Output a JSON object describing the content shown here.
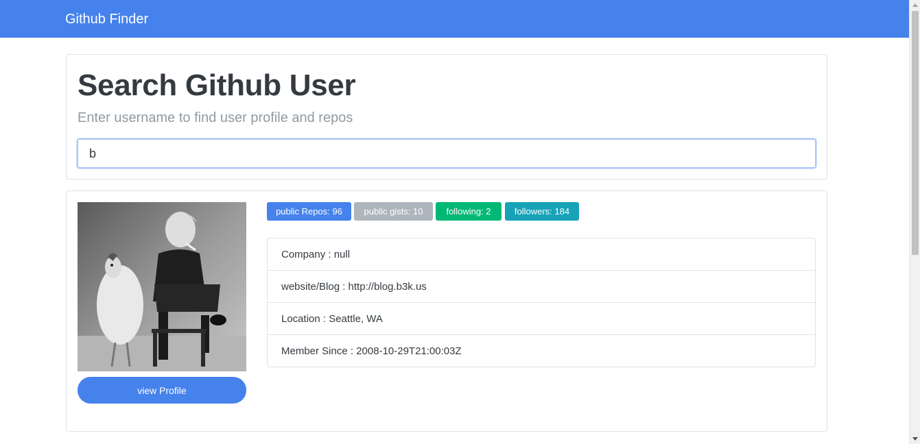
{
  "navbar": {
    "brand": "Github Finder"
  },
  "search": {
    "title": "Search Github User",
    "subtitle": "Enter username to find user profile and repos",
    "input_value": "b"
  },
  "profile": {
    "view_profile_label": "view Profile",
    "badges": {
      "public_repos": "public Repos: 96",
      "public_gists": "public gists: 10",
      "following": "following: 2",
      "followers": "followers: 184"
    },
    "info": {
      "company": "Company : null",
      "website": "website/Blog : http://blog.b3k.us",
      "location": "Location : Seattle, WA",
      "member_since": "Member Since : 2008-10-29T21:00:03Z"
    }
  },
  "colors": {
    "primary": "#4582ec",
    "secondary": "#adb5bd",
    "success": "#02b875",
    "info": "#17a2b8"
  }
}
